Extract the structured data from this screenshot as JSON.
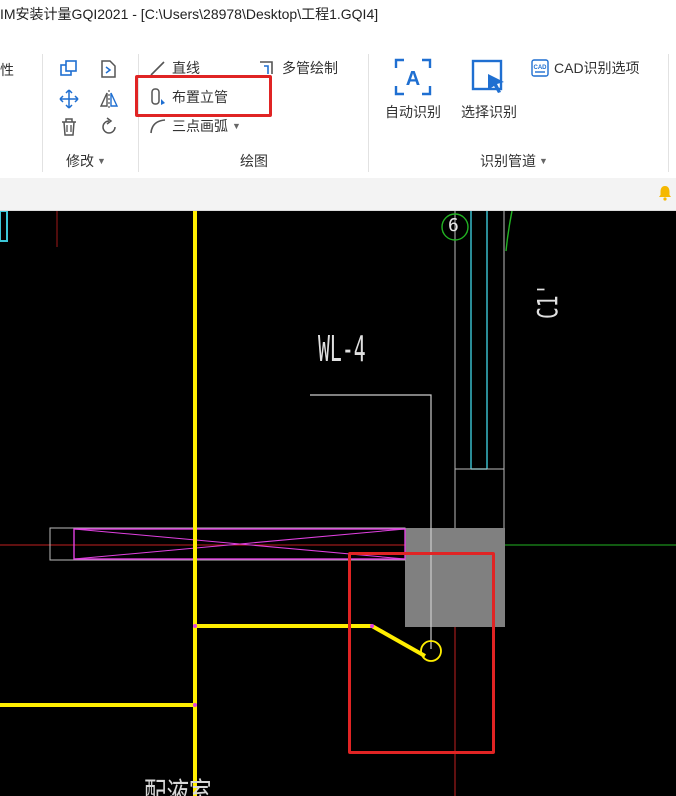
{
  "window": {
    "title": "IM安装计量GQI2021 - [C:\\Users\\28978\\Desktop\\工程1.GQI4]"
  },
  "ribbon": {
    "partial_left_label": "性",
    "groups": {
      "modify": {
        "label": "修改"
      },
      "draw": {
        "label": "绘图"
      },
      "recognize": {
        "label": "识别管道"
      }
    },
    "buttons": {
      "line": "直线",
      "multi_pipe": "多管绘制",
      "place_riser": "布置立管",
      "three_point_arc": "三点画弧",
      "cad_options": "CAD识别选项",
      "auto_recognize": "自动识别",
      "select_recognize": "选择识别"
    },
    "icons": {
      "copy": "copy-icon",
      "mirror_file": "mirror-icon",
      "move": "move-icon",
      "flip": "flip-icon",
      "delete": "delete-icon",
      "rotate": "rotate-icon"
    },
    "colors": {
      "accent": "#1f6fd1",
      "highlight": "#e02424"
    }
  },
  "canvas": {
    "labels": {
      "axis_number": "6",
      "pipe_label": "WL-4",
      "column_label": "C1'",
      "room_label": "配液室"
    },
    "colors": {
      "background": "#000000",
      "pipe": "#ffee00",
      "magenta": "#e040e0",
      "cyan": "#3cc7d8",
      "red_axis": "#d02020",
      "green_axis": "#22b322",
      "gray_block": "#808080"
    }
  }
}
